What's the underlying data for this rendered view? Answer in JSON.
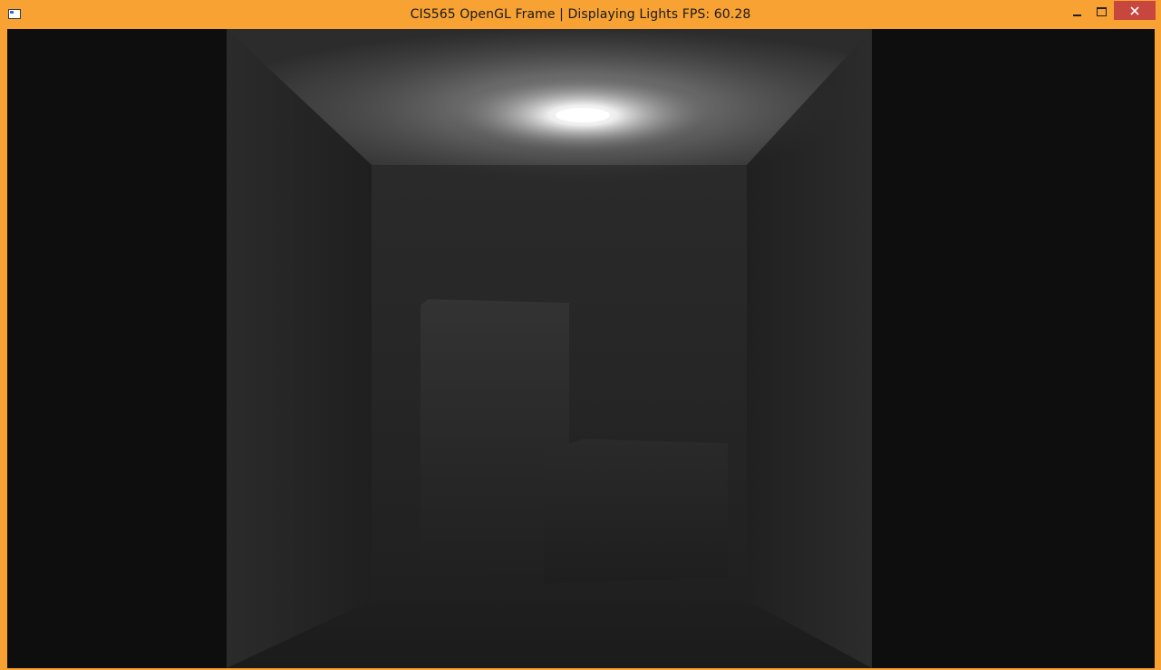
{
  "window": {
    "title": "CIS565 OpenGL Frame | Displaying Lights FPS: 60.28",
    "icon": "app-window-icon",
    "controls": {
      "minimize_icon": "minimize-icon",
      "maximize_icon": "maximize-icon",
      "close_icon": "close-icon",
      "close_color": "#c7463e"
    },
    "frame_color": "#f7a233"
  },
  "viewport": {
    "scene": "cornell-box",
    "background_color": "#0e0e0e",
    "light_color": "#ffffff"
  }
}
